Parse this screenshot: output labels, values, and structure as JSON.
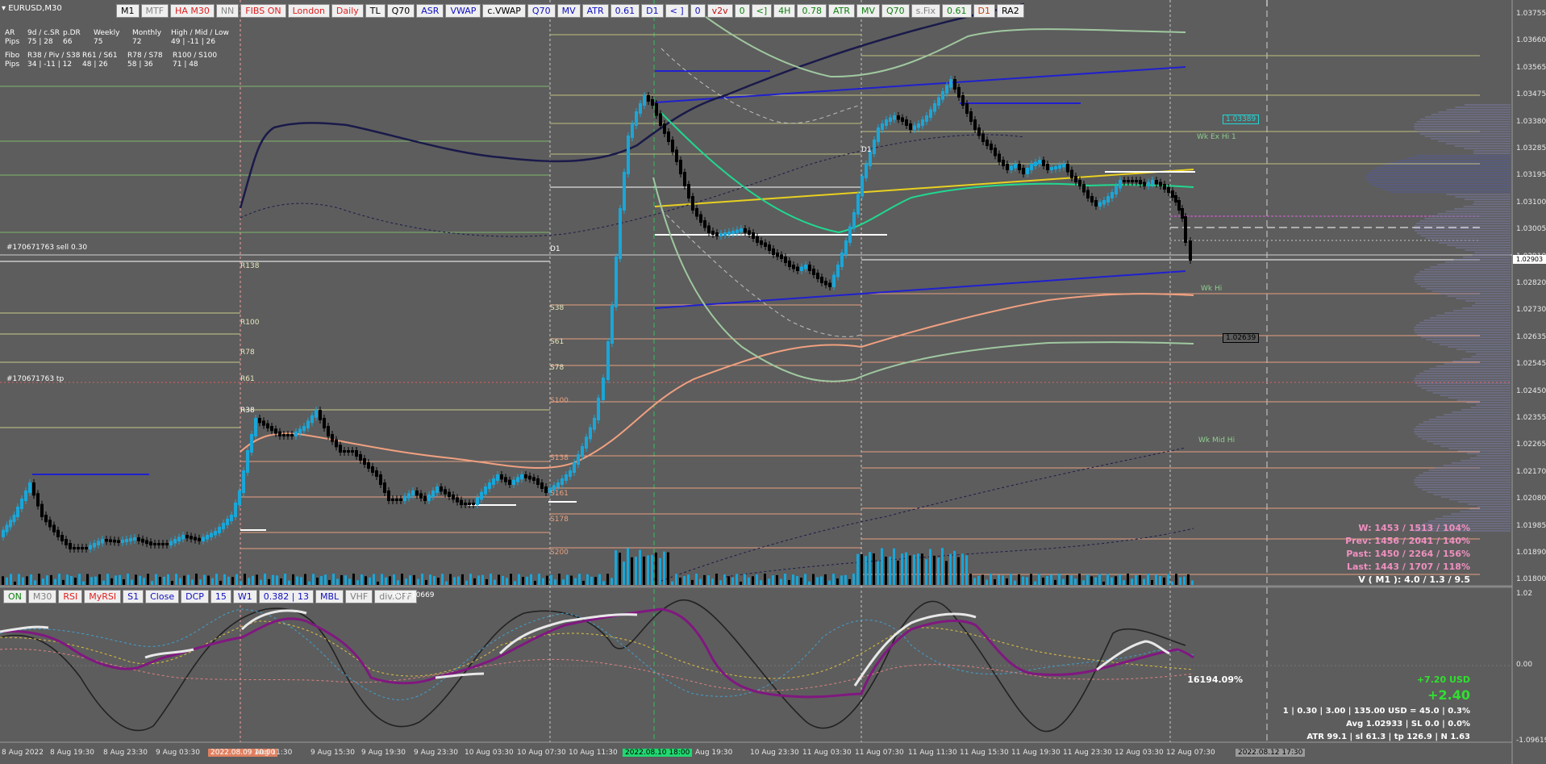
{
  "window": {
    "symbol": "EURUSD,M30"
  },
  "toolbar_top": [
    {
      "label": "M1",
      "color": "#000000"
    },
    {
      "label": "MTF",
      "color": "#888888"
    },
    {
      "label": "HA M30",
      "color": "#e02020"
    },
    {
      "label": "NN",
      "color": "#888888"
    },
    {
      "label": "FIBS ON",
      "color": "#e02020"
    },
    {
      "label": "London",
      "color": "#e02020"
    },
    {
      "label": "Daily",
      "color": "#e02020"
    },
    {
      "label": "TL",
      "color": "#000000"
    },
    {
      "label": "Q70",
      "color": "#000000"
    },
    {
      "label": "ASR",
      "color": "#1010c0"
    },
    {
      "label": "VWAP",
      "color": "#1010c0"
    },
    {
      "label": "c.VWAP",
      "color": "#000000"
    },
    {
      "label": "Q70",
      "color": "#1010c0"
    },
    {
      "label": "MV",
      "color": "#1010c0"
    },
    {
      "label": "ATR",
      "color": "#1010c0"
    },
    {
      "label": "0.61",
      "color": "#1010c0"
    },
    {
      "label": "D1",
      "color": "#1010c0"
    },
    {
      "label": "< ]",
      "color": "#1010c0"
    },
    {
      "label": "0",
      "color": "#1010c0"
    },
    {
      "label": "v2v",
      "color": "#c01010"
    },
    {
      "label": "0",
      "color": "#108010"
    },
    {
      "label": "<]",
      "color": "#108010"
    },
    {
      "label": "4H",
      "color": "#108010"
    },
    {
      "label": "0.78",
      "color": "#108010"
    },
    {
      "label": "ATR",
      "color": "#108010"
    },
    {
      "label": "MV",
      "color": "#108010"
    },
    {
      "label": "Q70",
      "color": "#108010"
    },
    {
      "label": "s.Fix",
      "color": "#808080"
    },
    {
      "label": "0.61",
      "color": "#108010"
    },
    {
      "label": "D1",
      "color": "#c04010"
    },
    {
      "label": "RA2",
      "color": "#000000"
    }
  ],
  "info": {
    "r1": [
      "AR",
      "9d / c.SR",
      "p.DR",
      "Weekly",
      "Monthly",
      "High / Mid / Low"
    ],
    "r2": [
      "Pips",
      "75 | 28",
      "66",
      "75",
      "72",
      "49 | -11 | 26"
    ],
    "r3": [
      "Fibo",
      "R38 / Piv / S38",
      "R61 / S61",
      "R78 / S78",
      "R100 / S100"
    ],
    "r4": [
      "Pips",
      "34 | -11 | 12",
      "48 | 26",
      "58 | 36",
      "71 | 48"
    ]
  },
  "chart_labels": {
    "sell_order": "#170671763 sell 0.30",
    "tp_order": "#170671763 tp",
    "wk_ex_hi": "Wk Ex Hi 1",
    "wk_hi": "Wk Hi",
    "wk_mid_hi": "Wk Mid Hi",
    "price_tag_1": "1.03389",
    "price_tag_2": "1.02639",
    "current_price": "1.02903"
  },
  "level_labels_a": [
    "R38",
    "R61",
    "R78",
    "R100",
    "R138",
    "S38",
    "S61",
    "S78",
    "S100",
    "S138",
    "S161",
    "S178",
    "S200",
    "D1",
    "D1"
  ],
  "price_axis": [
    "1.03755",
    "1.03660",
    "1.03565",
    "1.03475",
    "1.03380",
    "1.03285",
    "1.03195",
    "1.03100",
    "1.03005",
    "1.02910",
    "1.02820",
    "1.02730",
    "1.02635",
    "1.02545",
    "1.02450",
    "1.02355",
    "1.02265",
    "1.02170",
    "1.02080",
    "1.01985",
    "1.01890",
    "1.01800"
  ],
  "time_axis": [
    "8 Aug 2022",
    "8 Aug 19:30",
    "8 Aug 23:30",
    "9 Aug 03:30",
    "2022.08.09 10:00",
    "Aug 11:30",
    "9 Aug 15:30",
    "9 Aug 19:30",
    "9 Aug 23:30",
    "10 Aug 03:30",
    "10 Aug 07:30",
    "10 Aug 11:30",
    "2022.08.10 18:00",
    "Aug 19:30",
    "10 Aug 23:30",
    "11 Aug 03:30",
    "11 Aug 07:30",
    "11 Aug 11:30",
    "11 Aug 15:30",
    "11 Aug 19:30",
    "11 Aug 23:30",
    "12 Aug 03:30",
    "12 Aug 07:30",
    "2022.08.12 17:30"
  ],
  "stats": {
    "w": "W: 1453 / 1513 / 104%",
    "prev": "Prev: 1456 / 2041 / 140%",
    "past": "Past: 1450 / 2264 / 156%",
    "last": "Last: 1443 / 1707 / 118%",
    "vm1": "V ( M1 ): 4.0 / 1.3 / 9.5"
  },
  "toolbar_sub": [
    {
      "label": "ON",
      "color": "#108010"
    },
    {
      "label": "M30",
      "color": "#808080"
    },
    {
      "label": "RSI",
      "color": "#e02020"
    },
    {
      "label": "MyRSI",
      "color": "#e02020"
    },
    {
      "label": "S1",
      "color": "#1010c0"
    },
    {
      "label": "Close",
      "color": "#1010c0"
    },
    {
      "label": "DCP",
      "color": "#1010c0"
    },
    {
      "label": "15",
      "color": "#1010c0"
    },
    {
      "label": "W1",
      "color": "#1010c0"
    },
    {
      "label": "0.382 | 13",
      "color": "#1010c0"
    },
    {
      "label": "MBL",
      "color": "#1010c0"
    },
    {
      "label": "VHF",
      "color": "#808080"
    },
    {
      "label": "div.OFF",
      "color": "#808080"
    }
  ],
  "sub_value": "00 0.10669",
  "sub_axis": [
    "1.02",
    "0.00",
    "-1.09619"
  ],
  "account": {
    "pct": "16194.09%",
    "usd": "+7.20 USD",
    "big": "+2.40",
    "line1": "1  |  0.30  |  3.00  |  135.00 USD = 45.0  |  0.3%",
    "line2": "Avg 1.02933  |  SL 0.0  |  0.0%",
    "line3": "ATR 99.1  |  sl 61.3  |  tp 126.9  |  N 1.63"
  },
  "colors": {
    "bull": "#1aa6d8",
    "bear": "#000000",
    "bg": "#5d5d5d"
  }
}
